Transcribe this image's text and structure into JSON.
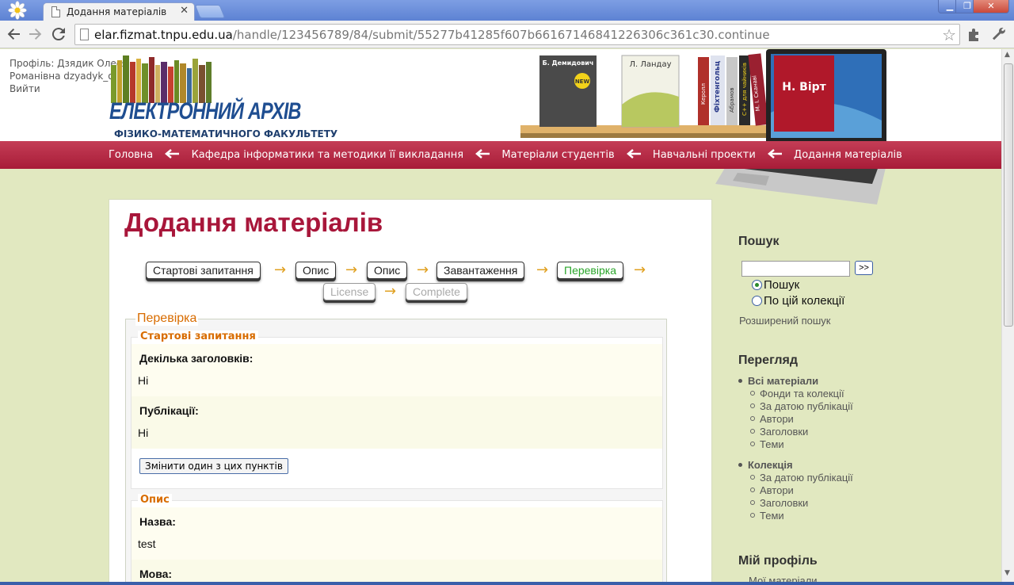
{
  "browser": {
    "tab_title": "Додання матеріалів",
    "tab_close": "✕",
    "url_host": "elar.fizmat.tnpu.edu.ua",
    "url_path": "/handle/123456789/84/submit/55277b41285f607b66167146841226306c361c30.continue",
    "window_min": "▁",
    "window_max": "❐",
    "window_close": "✕"
  },
  "header": {
    "user_line1": "Профіль: Дзядик Олеся",
    "user_line2": "Романівна dzyadyk_o",
    "logout": "Вийти",
    "logo_title": "ЕЛЕКТРОННИЙ АРХІВ",
    "logo_subtitle": "ФІЗИКО-МАТЕМАТИЧНОГО ФАКУЛЬТЕТУ",
    "books": {
      "b1": "Б. Демидович",
      "b1_badge": "NEW",
      "b2": "Л. Ландау",
      "b3": "Керолл",
      "b4": "Фіхтенгольц",
      "b5": "Абрамов",
      "b6": "C++ для чайників",
      "b7": "М. І. Сканаві",
      "b8": "Н. Вірт"
    }
  },
  "breadcrumb": [
    "Головна",
    "Кафедра інформатики та методики її викладання",
    "Матеріали студентів",
    "Навчальні проекти",
    "Додання матеріалів"
  ],
  "main": {
    "title": "Додання матеріалів",
    "steps": {
      "s1": "Стартові запитання",
      "s2": "Опис",
      "s3": "Опис",
      "s4": "Завантаження",
      "s5": "Перевірка",
      "s6": "License",
      "s7": "Complete"
    },
    "arrow": "→",
    "review_legend": "Перевірка",
    "section1": {
      "legend": "Стартові запитання",
      "q1_label": "Декілька заголовків:",
      "q1_value": "Ні",
      "q2_label": "Публікації:",
      "q2_value": "Ні",
      "edit_button": "Змінити один з цих пунктів"
    },
    "section2": {
      "legend": "Опис",
      "title_label": "Назва:",
      "title_value": "test",
      "lang_label": "Мова:"
    }
  },
  "sidebar": {
    "search_heading": "Пошук",
    "search_go": ">>",
    "radio1": "Пошук",
    "radio2": "По цій колекції",
    "advanced": "Розширений пошук",
    "browse_heading": "Перегляд",
    "all_items": "Всі матеріали",
    "all_links": [
      "Фонди та колекції",
      "За датою публікації",
      "Автори",
      "Заголовки",
      "Теми"
    ],
    "collection": "Колекція",
    "coll_links": [
      "За датою публікації",
      "Автори",
      "Заголовки",
      "Теми"
    ],
    "profile_heading": "Мій профіль",
    "profile_link": "Мої матеріали"
  }
}
